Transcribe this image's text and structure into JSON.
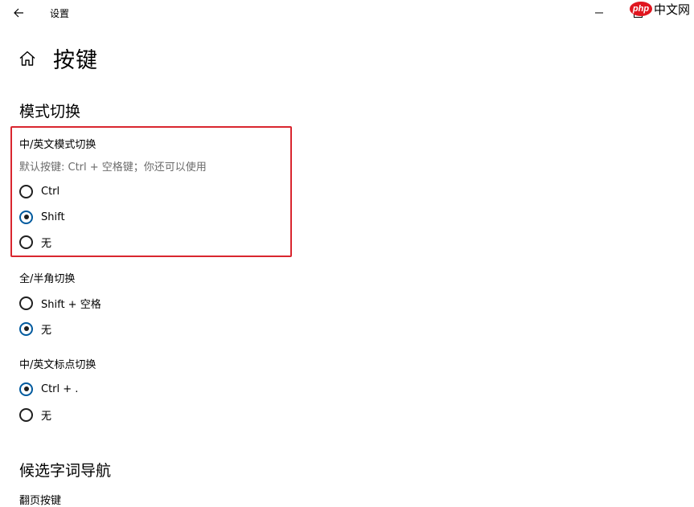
{
  "window": {
    "app_title": "设置",
    "watermark_logo": "php",
    "watermark_text": "中文网"
  },
  "page": {
    "title": "按键"
  },
  "sections": {
    "mode_switch": {
      "heading": "模式切换",
      "cn_en_mode": {
        "label": "中/英文模式切换",
        "description": "默认按键: Ctrl + 空格键；你还可以使用",
        "options": [
          {
            "label": "Ctrl",
            "checked": false
          },
          {
            "label": "Shift",
            "checked": true
          },
          {
            "label": "无",
            "checked": false
          }
        ]
      },
      "full_half": {
        "label": "全/半角切换",
        "options": [
          {
            "label": "Shift + 空格",
            "checked": false
          },
          {
            "label": "无",
            "checked": true
          }
        ]
      },
      "punct": {
        "label": "中/英文标点切换",
        "options": [
          {
            "label": "Ctrl + .",
            "checked": true
          },
          {
            "label": "无",
            "checked": false
          }
        ]
      }
    },
    "candidate_nav": {
      "heading": "候选字词导航",
      "next_label": "翻页按键"
    }
  },
  "colors": {
    "highlight_border": "#d9262f",
    "radio_checked_ring": "#005a9e",
    "description_text": "#6b6b6b",
    "watermark_red": "#e0161f"
  },
  "icons": {
    "back": "back-arrow-icon",
    "home": "home-icon",
    "minimize": "minimize-icon",
    "maximize": "maximize-icon"
  }
}
